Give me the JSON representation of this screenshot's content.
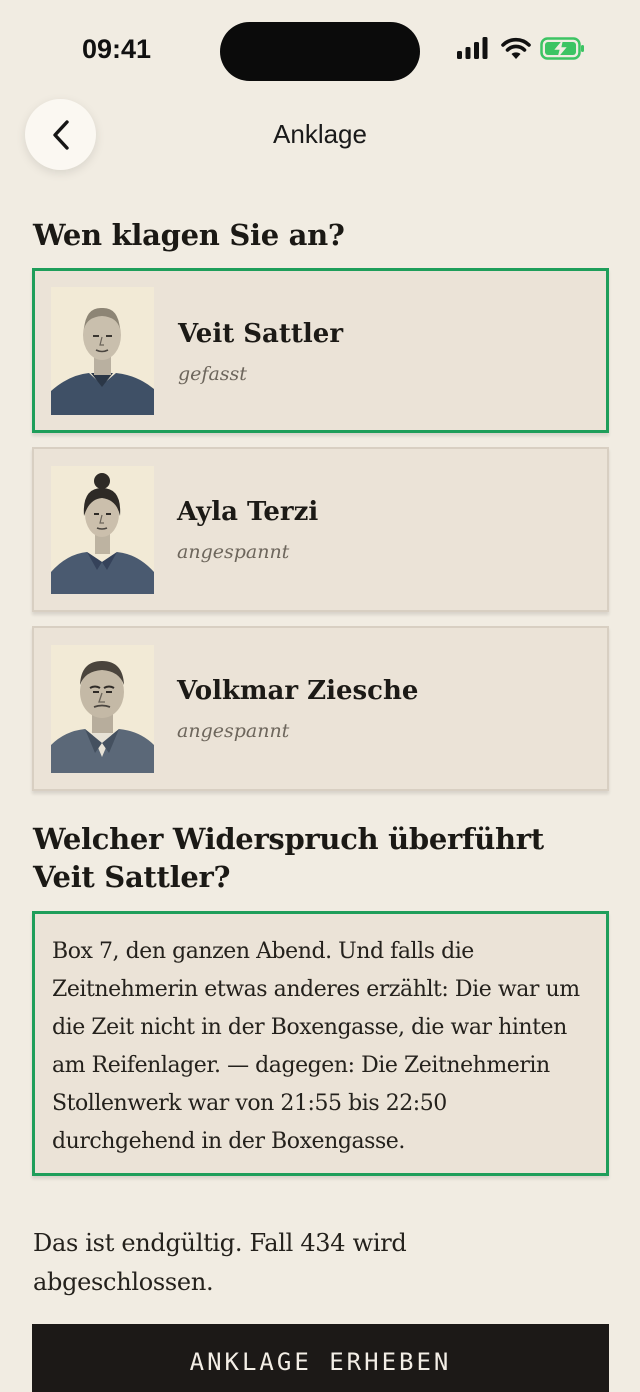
{
  "status_bar": {
    "time": "09:41",
    "icons": [
      "signal-icon",
      "wifi-icon",
      "battery-charging-icon"
    ],
    "battery_color": "#3cc463"
  },
  "header": {
    "title": "Anklage",
    "back_icon": "chevron-left-icon"
  },
  "accuse": {
    "title": "Wen klagen Sie an?",
    "suspects": [
      {
        "name": "Veit Sattler",
        "mood": "gefasst",
        "selected": true
      },
      {
        "name": "Ayla Terzi",
        "mood": "angespannt",
        "selected": false
      },
      {
        "name": "Volkmar Ziesche",
        "mood": "angespannt",
        "selected": false
      }
    ]
  },
  "contradiction": {
    "title": "Welcher Widerspruch überführt Veit Sattler?",
    "text": "Box 7, den ganzen Abend. Und falls die Zeitnehmerin etwas anderes erzählt: Die war um die Zeit nicht in der Boxengasse, die war hinten am Reifenlager. — dagegen: Die Zeitnehmerin Stollenwerk war von 21:55 bis 22:50 durchgehend in der Boxengasse."
  },
  "final_note": "Das ist endgültig. Fall 434 wird abgeschlossen.",
  "cta_label": "ANKLAGE ERHEBEN",
  "colors": {
    "background": "#f1ece2",
    "card": "#ebe3d7",
    "selected_border": "#1e9e5a",
    "button": "#1c1917"
  }
}
